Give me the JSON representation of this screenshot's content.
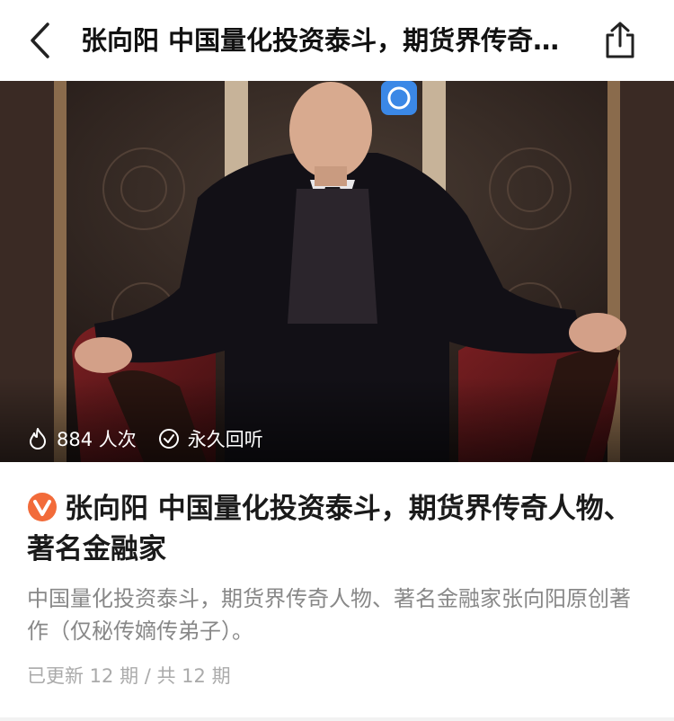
{
  "nav": {
    "title": "张向阳 中国量化投资泰斗，期货界传奇人物、著名金融家",
    "back_icon": "chevron-left-icon",
    "share_icon": "share-icon"
  },
  "cover": {
    "plays": "884 人次",
    "replay": "永久回听",
    "plays_icon": "flame-icon",
    "replay_icon": "check-circle-icon"
  },
  "course": {
    "title": "张向阳 中国量化投资泰斗，期货界传奇人物、著名金融家",
    "description": "中国量化投资泰斗，期货界传奇人物、著名金融家张向阳原创著作（仅秘传嫡传弟子）。",
    "episodes": "已更新 12 期 / 共 12 期",
    "badge_icon": "verified-badge-icon",
    "accent": "#f26b3a"
  }
}
